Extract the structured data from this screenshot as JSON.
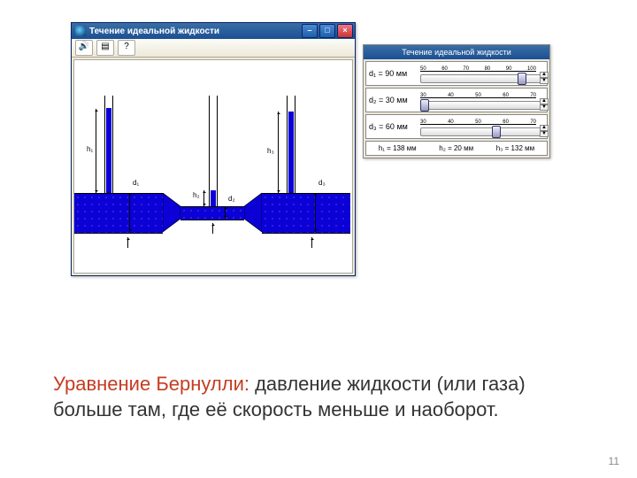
{
  "window": {
    "title": "Течение идеальной жидкости",
    "toolbar": {
      "sound": "🔊",
      "help": "?",
      "doc": "▤"
    }
  },
  "canvas_labels": {
    "h1": "h₁",
    "h2": "h₂",
    "h3": "h₃",
    "d1": "d₁",
    "d2": "d₂",
    "d3": "d₃"
  },
  "panel": {
    "title": "Течение идеальной жидкости",
    "rows": [
      {
        "label": "d₁ = 90 мм",
        "ticks": [
          "50",
          "60",
          "70",
          "80",
          "90",
          "100"
        ],
        "thumb_pct": 80
      },
      {
        "label": "d₂ = 30 мм",
        "ticks": [
          "30",
          "40",
          "50",
          "60",
          "70"
        ],
        "thumb_pct": 4
      },
      {
        "label": "d₃ = 60 мм",
        "ticks": [
          "30",
          "40",
          "50",
          "60",
          "70"
        ],
        "thumb_pct": 60
      }
    ],
    "results": {
      "h1": "h₁ = 138 мм",
      "h2": "h₂ = 20 мм",
      "h3": "h₃ = 132 мм"
    }
  },
  "caption": {
    "lead": "Уравнение Бернулли: ",
    "body": "давление жидкости (или газа) больше там, где её скорость меньше и наоборот."
  },
  "page": "11"
}
